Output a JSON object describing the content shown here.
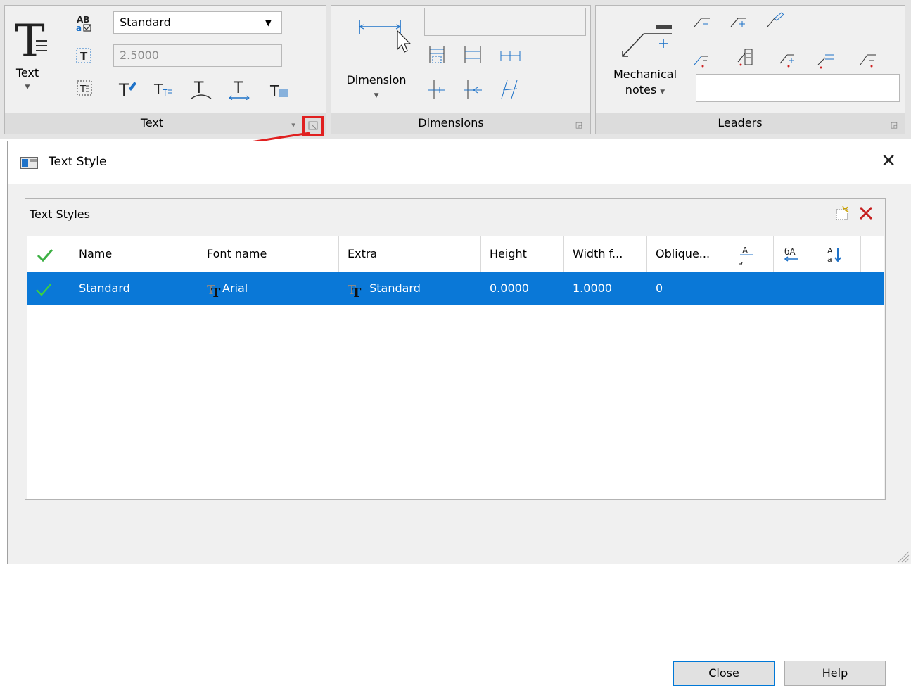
{
  "ribbon": {
    "text_panel": {
      "title": "Text",
      "big_button_label": "Text",
      "style_combo_value": "Standard",
      "height_field_value": "2.5000"
    },
    "dimensions_panel": {
      "title": "Dimensions",
      "big_button_label": "Dimension"
    },
    "leaders_panel": {
      "title": "Leaders",
      "big_button_label_line1": "Mechanical",
      "big_button_label_line2": "notes"
    }
  },
  "dialog": {
    "title": "Text Style",
    "group_title": "Text Styles",
    "columns": [
      "Name",
      "Font name",
      "Extra",
      "Height",
      "Width f...",
      "Oblique..."
    ],
    "rows": [
      {
        "name": "Standard",
        "font": "Arial",
        "extra": "Standard",
        "height": "0.0000",
        "width": "1.0000",
        "oblique": "0"
      }
    ],
    "close_label": "Close",
    "help_label": "Help"
  },
  "colors": {
    "accent": "#0a78d7",
    "annotation_red": "#e02020",
    "check_green": "#3cb043"
  },
  "icons": [
    "text-icon",
    "spell-check-icon",
    "text-height-icon",
    "text-frame-icon",
    "text-edit-icon",
    "check-icon",
    "new-style-icon",
    "delete-icon",
    "close-icon"
  ]
}
